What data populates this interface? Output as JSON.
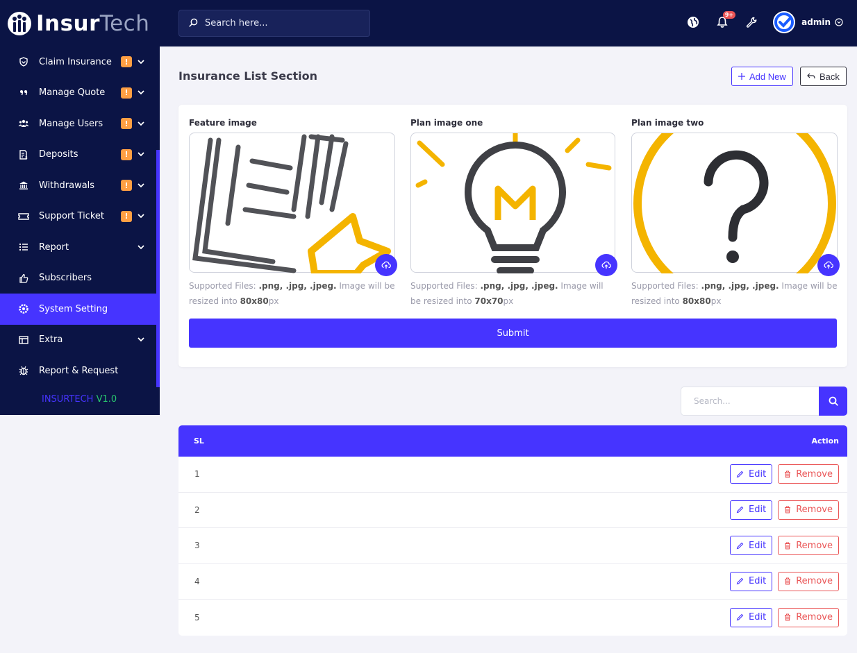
{
  "brand": {
    "part1": "Insur",
    "part2": "Tech"
  },
  "colors": {
    "primary": "#4634ff",
    "sidebar": "#0b1445",
    "warning": "#ff9f43",
    "danger": "#ea5455",
    "success": "#28c76f"
  },
  "sidebar": {
    "items": [
      {
        "label": "Claim Insurance",
        "icon": "shield-icon",
        "badge": "!",
        "caret": true
      },
      {
        "label": "Manage Quote",
        "icon": "quote-icon",
        "badge": "!",
        "caret": true
      },
      {
        "label": "Manage Users",
        "icon": "users-icon",
        "badge": "!",
        "caret": true
      },
      {
        "label": "Deposits",
        "icon": "invoice-icon",
        "badge": "!",
        "caret": true
      },
      {
        "label": "Withdrawals",
        "icon": "bank-icon",
        "badge": "!",
        "caret": true
      },
      {
        "label": "Support Ticket",
        "icon": "ticket-icon",
        "badge": "!",
        "caret": true
      },
      {
        "label": "Report",
        "icon": "list-icon",
        "caret": true
      },
      {
        "label": "Subscribers",
        "icon": "thumbs-up-icon"
      },
      {
        "label": "System Setting",
        "icon": "settings-icon",
        "active": true
      },
      {
        "label": "Extra",
        "icon": "cards-icon",
        "caret": true
      },
      {
        "label": "Report & Request",
        "icon": "bug-icon"
      }
    ],
    "version_name": "INSURTECH",
    "version_number": "V1.0"
  },
  "topbar": {
    "search_placeholder": "Search here...",
    "notification_count": "9+",
    "user_name": "admin"
  },
  "page": {
    "title": "Insurance List Section",
    "add_new_label": "Add New",
    "back_label": "Back"
  },
  "uploads": [
    {
      "label": "Feature image",
      "help_prefix": "Supported Files: ",
      "help_types": ".png, .jpg, .jpeg.",
      "help_mid": " Image will be resized into ",
      "help_size": "80x80",
      "help_unit": "px"
    },
    {
      "label": "Plan image one",
      "help_prefix": "Supported Files: ",
      "help_types": ".png, .jpg, .jpeg.",
      "help_mid": " Image will be resized into ",
      "help_size": "70x70",
      "help_unit": "px"
    },
    {
      "label": "Plan image two",
      "help_prefix": "Supported Files: ",
      "help_types": ".png, .jpg, .jpeg.",
      "help_mid": " Image will be resized into ",
      "help_size": "80x80",
      "help_unit": "px"
    }
  ],
  "submit_label": "Submit",
  "table": {
    "search_placeholder": "Search...",
    "columns": [
      "SL",
      "Action"
    ],
    "edit_label": "Edit",
    "remove_label": "Remove",
    "rows": [
      {
        "sl": "1"
      },
      {
        "sl": "2"
      },
      {
        "sl": "3"
      },
      {
        "sl": "4"
      },
      {
        "sl": "5"
      }
    ]
  }
}
